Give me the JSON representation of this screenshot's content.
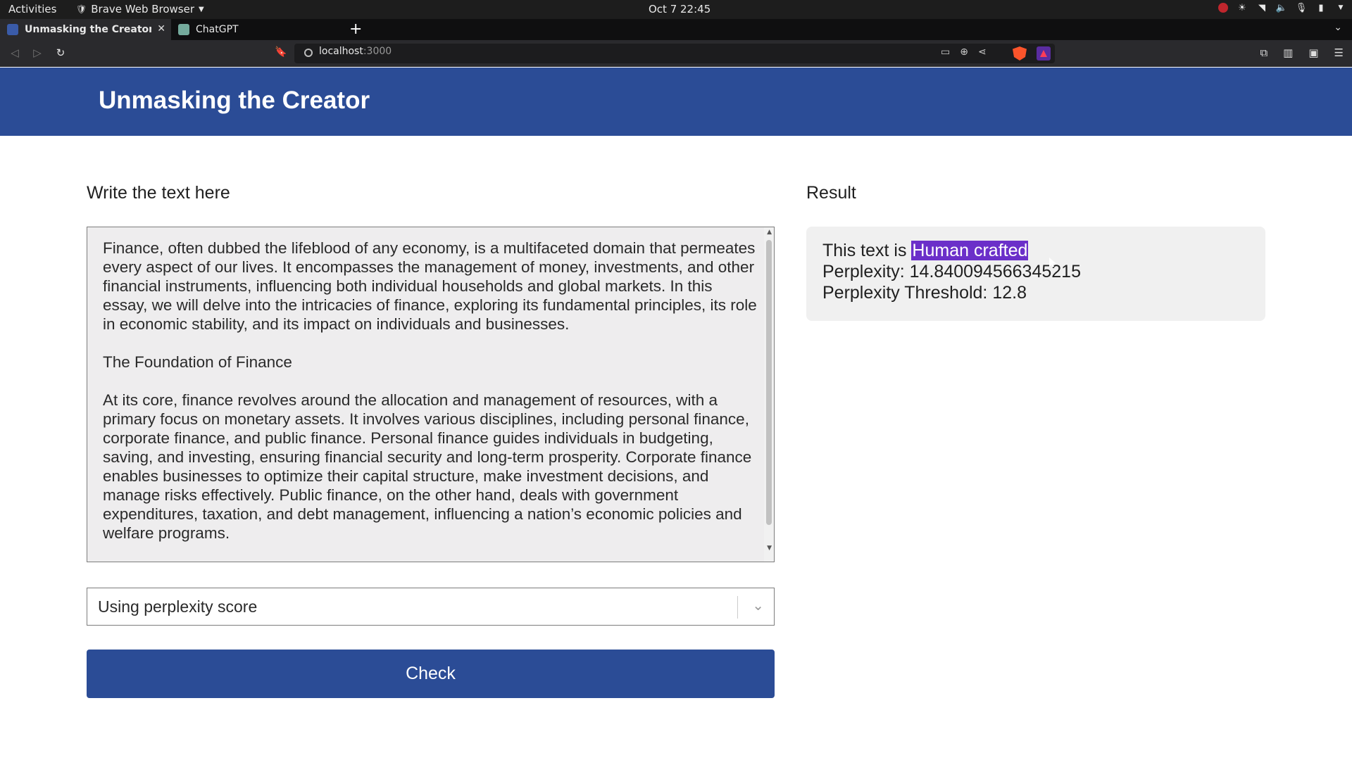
{
  "system": {
    "activities": "Activities",
    "app_name": "Brave Web Browser",
    "clock": "Oct 7  22:45"
  },
  "browser": {
    "tabs": [
      {
        "title": "Unmasking the Creator: I"
      },
      {
        "title": "ChatGPT"
      }
    ],
    "url_host": "localhost",
    "url_port": ":3000"
  },
  "app": {
    "title": "Unmasking the Creator",
    "input_label": "Write the text here",
    "input_text": "Finance, often dubbed the lifeblood of any economy, is a multifaceted domain that permeates every aspect of our lives. It encompasses the management of money, investments, and other financial instruments, influencing both individual households and global markets. In this essay, we will delve into the intricacies of finance, exploring its fundamental principles, its role in economic stability, and its impact on individuals and businesses.\n\nThe Foundation of Finance\n\nAt its core, finance revolves around the allocation and management of resources, with a primary focus on monetary assets. It involves various disciplines, including personal finance, corporate finance, and public finance. Personal finance guides individuals in budgeting, saving, and investing, ensuring financial security and long-term prosperity. Corporate finance enables businesses to optimize their capital structure, make investment decisions, and manage risks effectively. Public finance, on the other hand, deals with government expenditures, taxation, and debt management, influencing a nation’s economic policies and welfare programs.",
    "method_selected": "Using perplexity score",
    "check_label": "Check",
    "result_label": "Result",
    "result": {
      "prefix": "This text is ",
      "verdict": "Human crafted",
      "perplexity_line": "Perplexity: 14.840094566345215",
      "threshold_line": "Perplexity Threshold: 12.8"
    }
  },
  "colors": {
    "header": "#2b4c96",
    "button": "#2b4c96",
    "highlight": "#6b2fc9"
  }
}
